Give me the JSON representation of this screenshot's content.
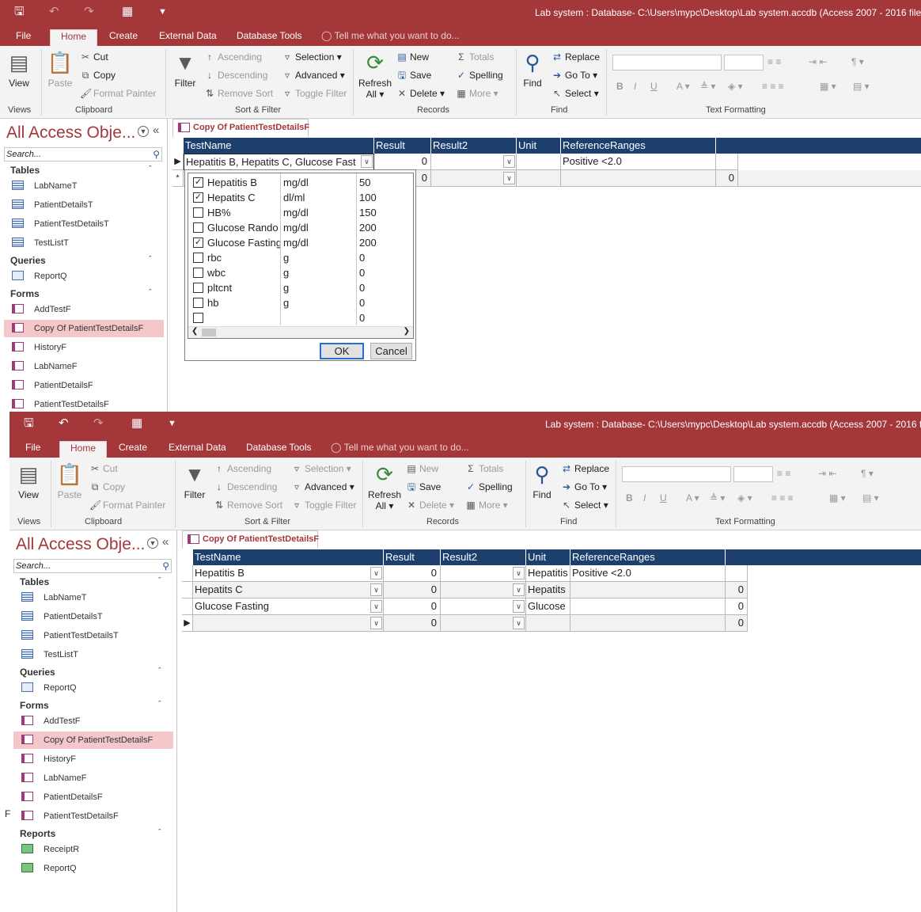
{
  "window": {
    "title": "Lab system : Database- C:\\Users\\mypc\\Desktop\\Lab system.accdb (Access 2007 - 2016 file fo",
    "title2": "Lab system : Database- C:\\Users\\mypc\\Desktop\\Lab system.accdb (Access 2007 - 2016 file"
  },
  "ribbon_tabs": [
    "File",
    "Home",
    "Create",
    "External Data",
    "Database Tools"
  ],
  "tell_me": "Tell me what you want to do...",
  "ribbon": {
    "view": "View",
    "paste": "Paste",
    "cut": "Cut",
    "copy": "Copy",
    "format_painter": "Format Painter",
    "filter": "Filter",
    "ascending": "Ascending",
    "descending": "Descending",
    "remove_sort": "Remove Sort",
    "selection": "Selection",
    "advanced": "Advanced",
    "toggle_filter": "Toggle Filter",
    "refresh_all": "Refresh",
    "refresh_all2": "All",
    "new": "New",
    "save": "Save",
    "delete": "Delete",
    "totals": "Totals",
    "spelling": "Spelling",
    "more": "More",
    "find": "Find",
    "replace": "Replace",
    "go_to": "Go To",
    "select": "Select",
    "groups": {
      "views": "Views",
      "clipboard": "Clipboard",
      "sort_filter": "Sort & Filter",
      "records": "Records",
      "find": "Find",
      "text_formatting": "Text Formatting"
    }
  },
  "nav": {
    "title": "All Access Obje...",
    "search_placeholder": "Search...",
    "sections": {
      "tables": "Tables",
      "queries": "Queries",
      "forms": "Forms",
      "reports": "Reports"
    },
    "tables": [
      "LabNameT",
      "PatientDetailsT",
      "PatientTestDetailsT",
      "TestListT"
    ],
    "queries": [
      "ReportQ"
    ],
    "forms": [
      "AddTestF",
      "Copy Of PatientTestDetailsF",
      "HistoryF",
      "LabNameF",
      "PatientDetailsF",
      "PatientTestDetailsF"
    ],
    "reports": [
      "ReceiptR",
      "ReportQ"
    ]
  },
  "document_tab": "Copy Of PatientTestDetailsF",
  "grid": {
    "columns": [
      "TestName",
      "Result",
      "Result2",
      "Unit",
      "ReferenceRanges"
    ]
  },
  "top": {
    "row1": {
      "test_name": "Hepatitis B, Hepatits C, Glucose Fast",
      "result": "0",
      "reference": "Positive <2.0"
    },
    "row2": {
      "result": "0",
      "extra": "0"
    },
    "popup": {
      "items": [
        {
          "name": "Hepatitis B",
          "unit": "mg/dl",
          "value": "50",
          "checked": true
        },
        {
          "name": "Hepatits C",
          "unit": "dl/ml",
          "value": "100",
          "checked": true
        },
        {
          "name": "HB%",
          "unit": "mg/dl",
          "value": "150",
          "checked": false
        },
        {
          "name": "Glucose Rando",
          "unit": "mg/dl",
          "value": "200",
          "checked": false
        },
        {
          "name": "Glucose Fasting",
          "unit": "mg/dl",
          "value": "200",
          "checked": true
        },
        {
          "name": "rbc",
          "unit": "g",
          "value": "0",
          "checked": false
        },
        {
          "name": "wbc",
          "unit": "g",
          "value": "0",
          "checked": false
        },
        {
          "name": "pltcnt",
          "unit": "g",
          "value": "0",
          "checked": false
        },
        {
          "name": "hb",
          "unit": "g",
          "value": "0",
          "checked": false
        },
        {
          "name": "",
          "unit": "",
          "value": "0",
          "checked": false
        }
      ],
      "ok": "OK",
      "cancel": "Cancel"
    }
  },
  "bottom": {
    "rows": [
      {
        "test_name": "Hepatitis B",
        "result": "0",
        "unit": "Hepatitis",
        "reference": "Positive <2.0",
        "extra": ""
      },
      {
        "test_name": "Hepatits C",
        "result": "0",
        "unit": "Hepatits",
        "reference": "",
        "extra": "0"
      },
      {
        "test_name": "Glucose Fasting",
        "result": "0",
        "unit": "Glucose",
        "reference": "",
        "extra": "0"
      },
      {
        "test_name": "",
        "result": "0",
        "unit": "",
        "reference": "",
        "extra": "0"
      }
    ],
    "left_fragment": "F"
  },
  "colors": {
    "accent": "#a4373a",
    "header": "#1d3f6e",
    "nav_selected": "#f4c7ca"
  }
}
